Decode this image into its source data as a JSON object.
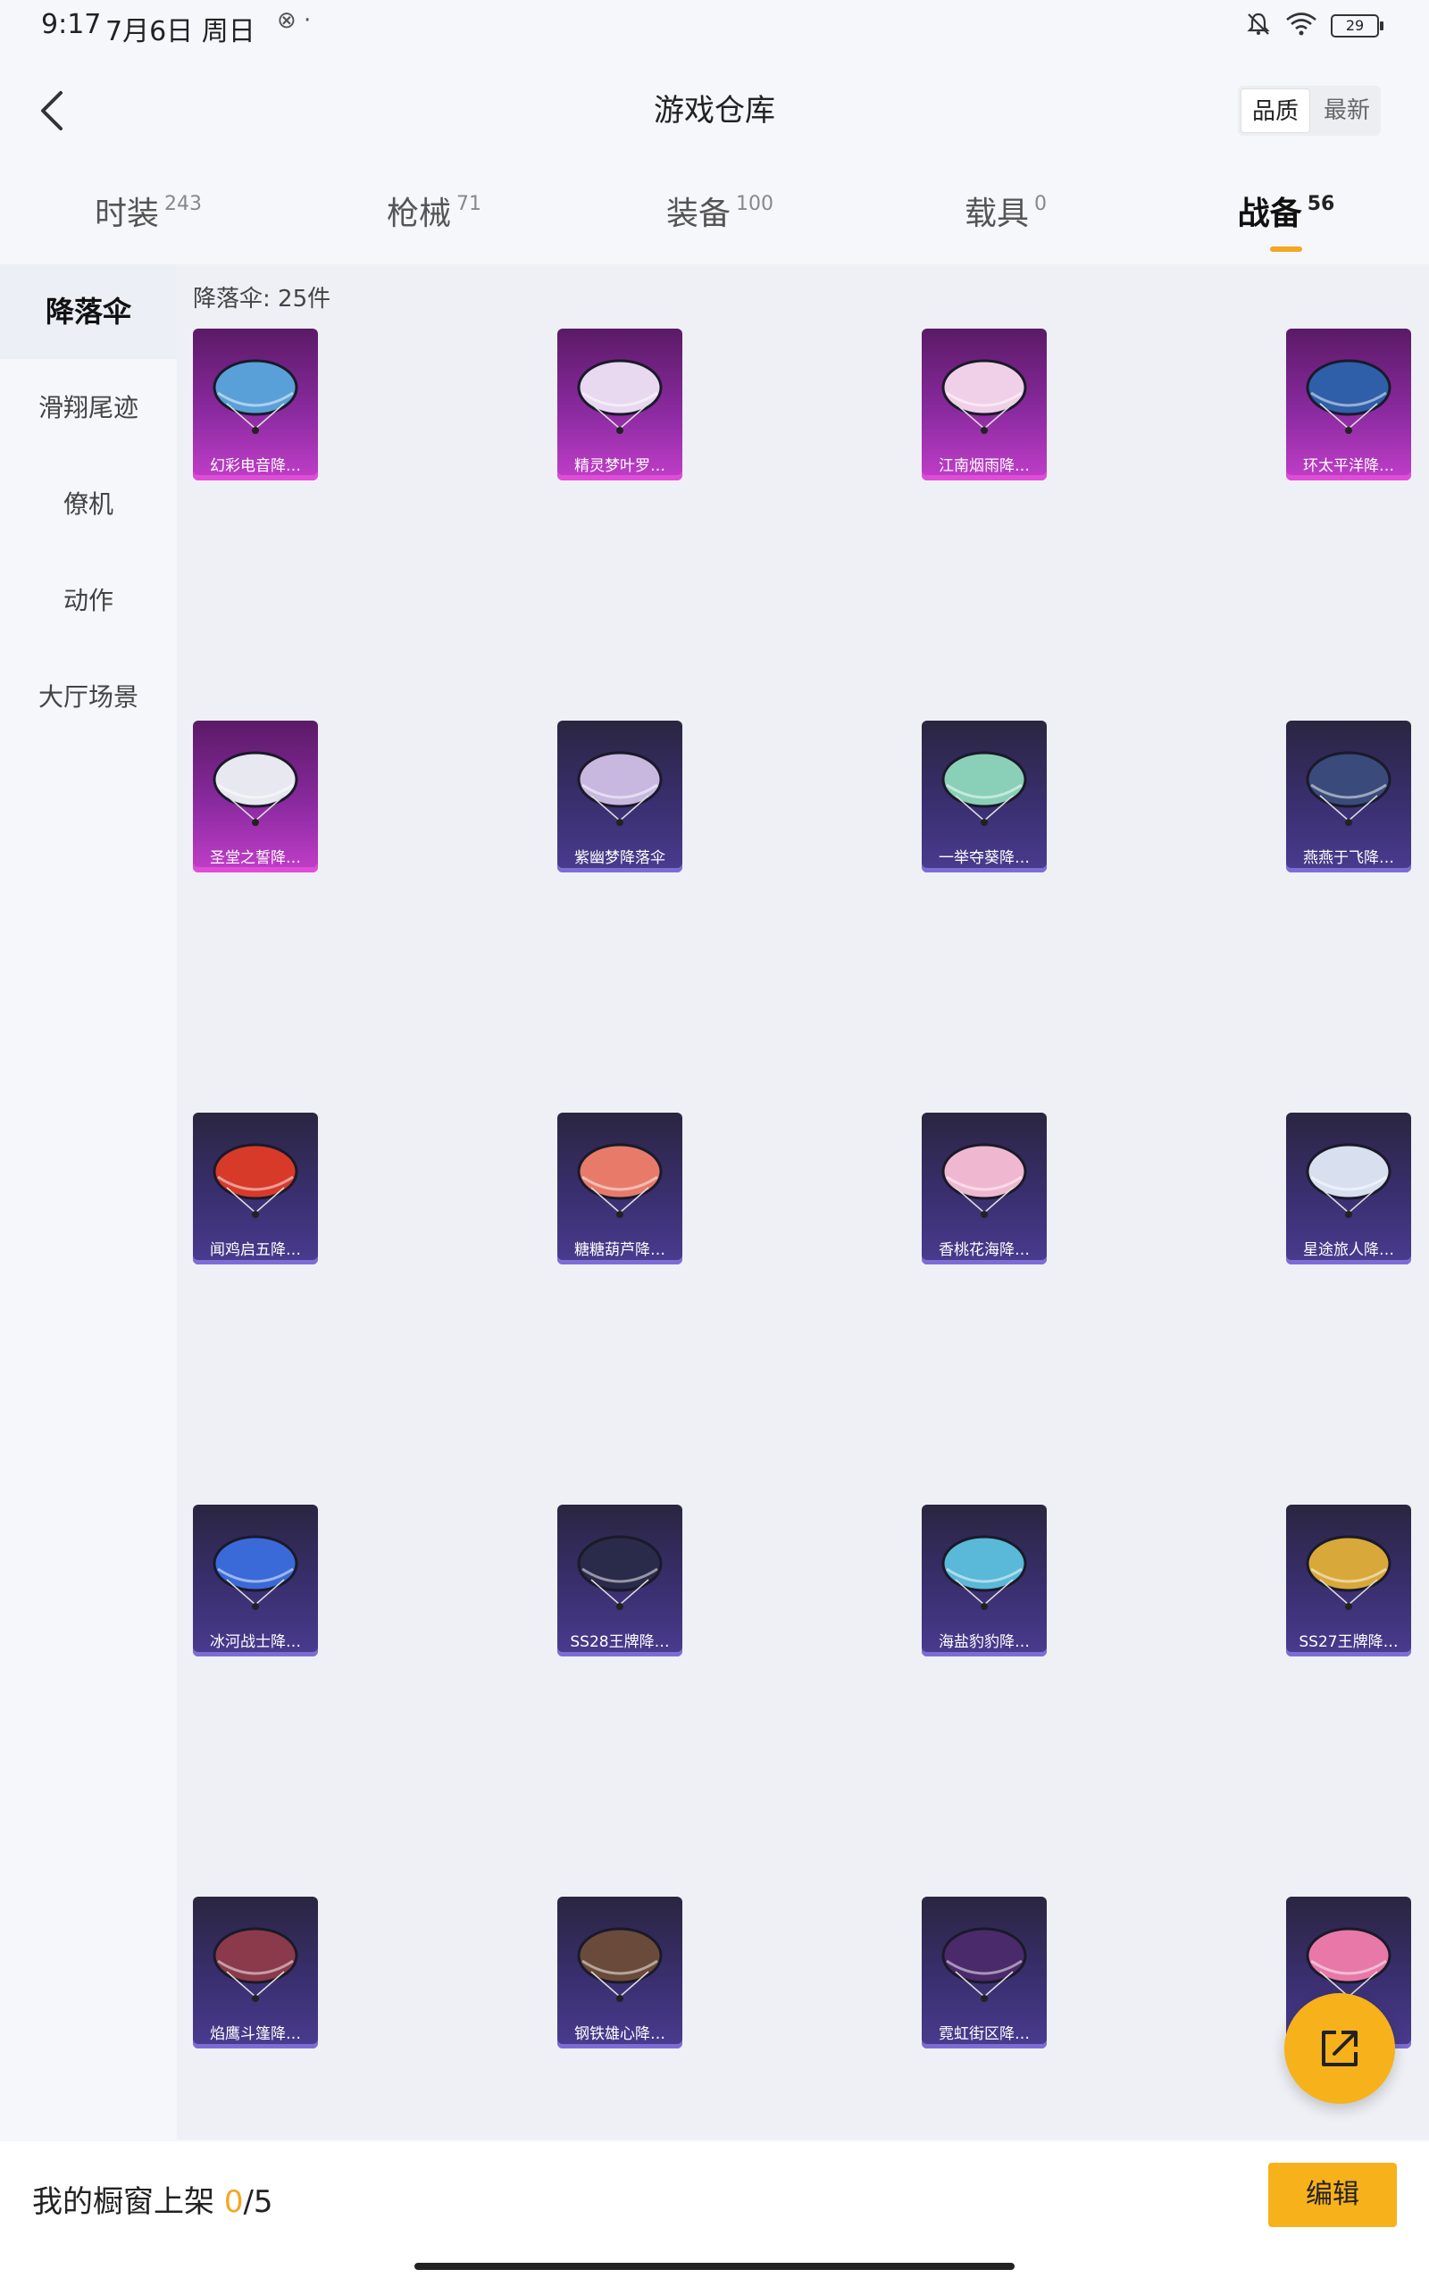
{
  "status": {
    "time": "9:17",
    "date": "7月6日 周日",
    "dots": "⊗ ·",
    "battery": "29"
  },
  "header": {
    "title": "游戏仓库",
    "sort_quality": "品质",
    "sort_latest": "最新"
  },
  "tabs": [
    {
      "label": "时装",
      "count": "243"
    },
    {
      "label": "枪械",
      "count": "71"
    },
    {
      "label": "装备",
      "count": "100"
    },
    {
      "label": "载具",
      "count": "0"
    },
    {
      "label": "战备",
      "count": "56"
    }
  ],
  "sidebar": {
    "items": [
      {
        "label": "降落伞"
      },
      {
        "label": "滑翔尾迹"
      },
      {
        "label": "僚机"
      },
      {
        "label": "动作"
      },
      {
        "label": "大厅场景"
      }
    ]
  },
  "main": {
    "count_label": "降落伞: 25件",
    "items": [
      {
        "name": "幻彩电音降…",
        "rarity": "purple",
        "canopy": "#5aa0d8"
      },
      {
        "name": "精灵梦叶罗…",
        "rarity": "purple",
        "canopy": "#e8d8f0"
      },
      {
        "name": "江南烟雨降…",
        "rarity": "purple",
        "canopy": "#f0d0e8"
      },
      {
        "name": "环太平洋降…",
        "rarity": "purple",
        "canopy": "#2e5fa8"
      },
      {
        "name": "圣堂之誓降…",
        "rarity": "purple",
        "canopy": "#e8e8f0"
      },
      {
        "name": "紫幽梦降落伞",
        "rarity": "blue",
        "canopy": "#c8b8e0"
      },
      {
        "name": "一举夺葵降…",
        "rarity": "blue",
        "canopy": "#8ad0b8"
      },
      {
        "name": "燕燕于飞降…",
        "rarity": "blue",
        "canopy": "#3a4a7a"
      },
      {
        "name": "闻鸡启五降…",
        "rarity": "blue",
        "canopy": "#d83a2a"
      },
      {
        "name": "糖糖葫芦降…",
        "rarity": "blue",
        "canopy": "#e87a6a"
      },
      {
        "name": "香桃花海降…",
        "rarity": "blue",
        "canopy": "#f0b8d0"
      },
      {
        "name": "星途旅人降…",
        "rarity": "blue",
        "canopy": "#d8e0f0"
      },
      {
        "name": "冰河战士降…",
        "rarity": "blue",
        "canopy": "#3a6ad8"
      },
      {
        "name": "SS28王牌降…",
        "rarity": "blue",
        "canopy": "#2a2a4a"
      },
      {
        "name": "海盐豹豹降…",
        "rarity": "blue",
        "canopy": "#5ab8d8"
      },
      {
        "name": "SS27王牌降…",
        "rarity": "blue",
        "canopy": "#d8a83a"
      },
      {
        "name": "焰鹰斗篷降…",
        "rarity": "blue",
        "canopy": "#8a3a4a"
      },
      {
        "name": "钢铁雄心降…",
        "rarity": "blue",
        "canopy": "#6a4a3a"
      },
      {
        "name": "霓虹街区降…",
        "rarity": "blue",
        "canopy": "#4a2a6a"
      },
      {
        "name": "",
        "rarity": "blue",
        "canopy": "#e878a8"
      }
    ]
  },
  "bottom": {
    "shelf_prefix": "我的橱窗上架 ",
    "shelf_num": "0",
    "shelf_total": "/5",
    "edit_label": "编辑"
  },
  "colors": {
    "accent": "#f7b11b",
    "purple_rarity": "#c13ec9",
    "blue_rarity": "#4a3b8f"
  },
  "icons": [
    "back-chevron-icon",
    "bell-off-icon",
    "wifi-icon",
    "battery-icon",
    "share-external-icon"
  ]
}
